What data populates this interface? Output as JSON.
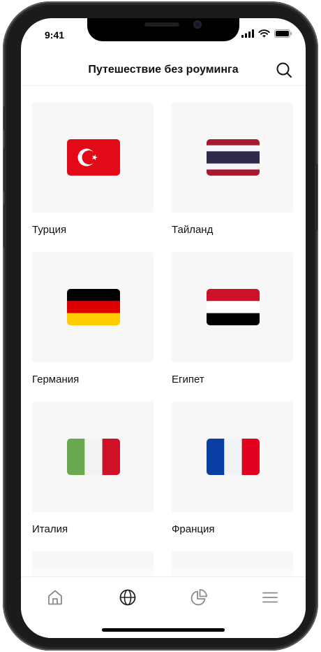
{
  "status_bar": {
    "time": "9:41"
  },
  "header": {
    "title": "Путешествие без роуминга"
  },
  "countries": [
    {
      "name": "Турция",
      "flag": "turkey-flag-icon"
    },
    {
      "name": "Тайланд",
      "flag": "thailand-flag-icon"
    },
    {
      "name": "Германия",
      "flag": "germany-flag-icon"
    },
    {
      "name": "Египет",
      "flag": "egypt-flag-icon"
    },
    {
      "name": "Италия",
      "flag": "italy-flag-icon"
    },
    {
      "name": "Франция",
      "flag": "france-flag-icon"
    }
  ],
  "bottom_nav": [
    {
      "icon": "home-icon",
      "active": false
    },
    {
      "icon": "globe-icon",
      "active": true
    },
    {
      "icon": "pie-chart-icon",
      "active": false
    },
    {
      "icon": "menu-icon",
      "active": false
    }
  ],
  "colors": {
    "text": "#111111",
    "card_bg": "#f7f7f8",
    "nav_inactive": "#8a8a8f",
    "nav_active": "#222222",
    "turkey_red": "#e30a17",
    "germany_red": "#dd0000",
    "germany_gold": "#ffce00",
    "egypt_red": "#ce1126",
    "italy_green": "#6aa84f",
    "italy_red": "#ce1126",
    "france_blue": "#0a3ea4",
    "france_red": "#e1001e",
    "thailand_red": "#a51931",
    "thailand_blue": "#2d2a4a"
  }
}
